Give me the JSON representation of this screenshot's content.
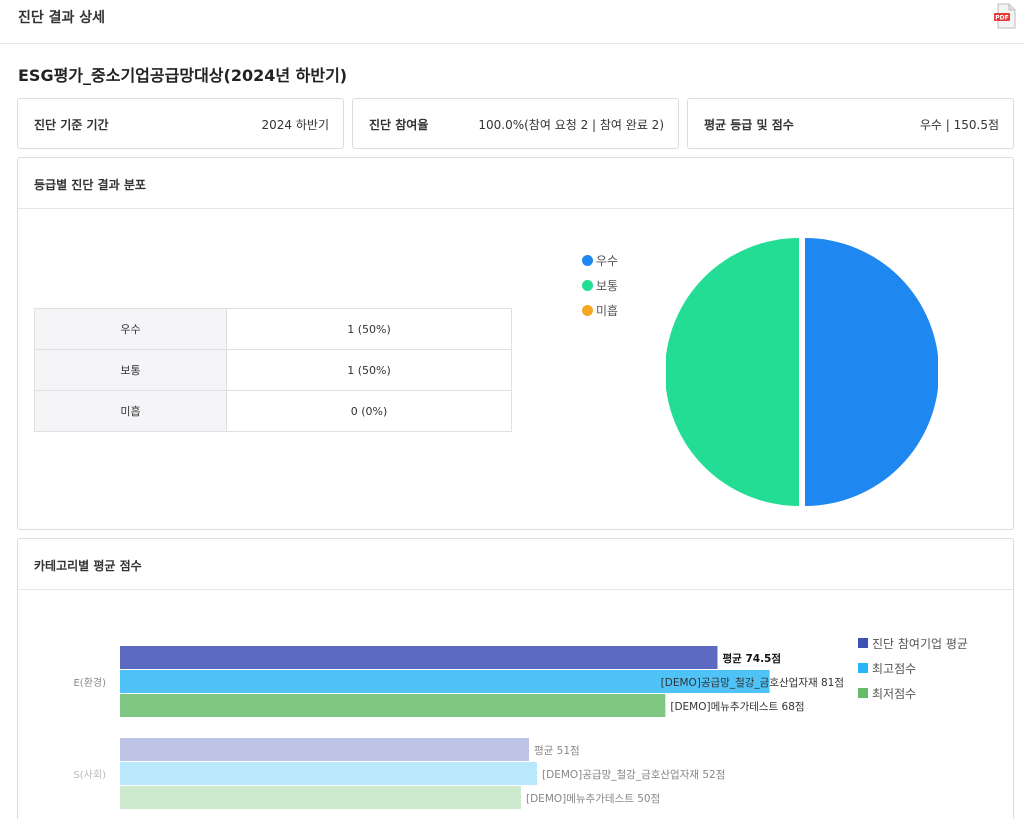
{
  "header": {
    "title": "진단 결과 상세",
    "pdf_icon": "pdf-file-icon"
  },
  "page_title": "ESG평가_중소기업공급망대상(2024년 하반기)",
  "stats": [
    {
      "label": "진단 기준 기간",
      "value": "2024 하반기"
    },
    {
      "label": "진단 참여율",
      "value": "100.0%(참여 요청 2 | 참여 완료 2)"
    },
    {
      "label": "평균 등급 및 점수",
      "value": "우수 | 150.5점"
    }
  ],
  "distribution": {
    "title": "등급별 진단 결과 분포",
    "rows": [
      {
        "grade": "우수",
        "value": "1 (50%)"
      },
      {
        "grade": "보통",
        "value": "1 (50%)"
      },
      {
        "grade": "미흡",
        "value": "0 (0%)"
      }
    ],
    "legend": [
      {
        "label": "우수",
        "color": "#1E88F0"
      },
      {
        "label": "보통",
        "color": "#22DD93"
      },
      {
        "label": "미흡",
        "color": "#F5A623"
      }
    ]
  },
  "category": {
    "title": "카테고리별 평균 점수",
    "legend": [
      {
        "label": "진단 참여기업 평균",
        "color": "#3F51B5"
      },
      {
        "label": "최고점수",
        "color": "#29B6F6"
      },
      {
        "label": "최저점수",
        "color": "#66BB6A"
      }
    ]
  },
  "chart_data": [
    {
      "type": "pie",
      "categories": [
        "우수",
        "보통",
        "미흡"
      ],
      "values": [
        1,
        1,
        0
      ],
      "colors": [
        "#1E88F0",
        "#22DD93",
        "#F5A623"
      ]
    },
    {
      "type": "bar",
      "orientation": "horizontal",
      "categories": [
        "E(환경)",
        "S(사회)"
      ],
      "series": [
        {
          "name": "진단 참여기업 평균",
          "values": [
            74.5,
            51
          ],
          "labels": [
            "평균 74.5점",
            "평균 51점"
          ],
          "color": "#5C6BC0"
        },
        {
          "name": "최고점수",
          "values": [
            81,
            52
          ],
          "labels": [
            "[DEMO]공급망_철강_금호산업자재 81점",
            "[DEMO]공급망_철강_금호산업자재 52점"
          ],
          "color": "#4FC3F7"
        },
        {
          "name": "최저점수",
          "values": [
            68,
            50
          ],
          "labels": [
            "[DEMO]메뉴추가테스트 68점",
            "[DEMO]메뉴추가테스트 50점"
          ],
          "color": "#81C784"
        }
      ]
    }
  ]
}
